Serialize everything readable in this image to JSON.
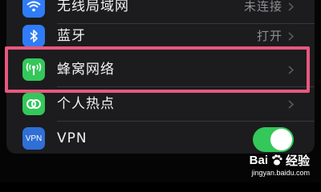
{
  "settings": {
    "rows": [
      {
        "label": "无线局域网",
        "value": "未连接",
        "icon": "wifi-icon",
        "color": "#2f7cf6"
      },
      {
        "label": "蓝牙",
        "value": "打开",
        "icon": "bluetooth-icon",
        "color": "#2f7cf6"
      },
      {
        "label": "蜂窝网络",
        "value": "",
        "icon": "cellular-antenna-icon",
        "color": "#34c759"
      },
      {
        "label": "个人热点",
        "value": "",
        "icon": "personal-hotspot-icon",
        "color": "#34c759"
      },
      {
        "label": "VPN",
        "value": "",
        "icon": "vpn-icon",
        "color": "#2f6fd6",
        "icon_text": "VPN",
        "toggle_on": true
      }
    ]
  },
  "highlight": {
    "target": "蜂窝网络",
    "color": "#e8587e"
  },
  "watermark": {
    "brand_left": "Bai",
    "brand_right": "经验",
    "url": "jingyan.baidu.com"
  }
}
